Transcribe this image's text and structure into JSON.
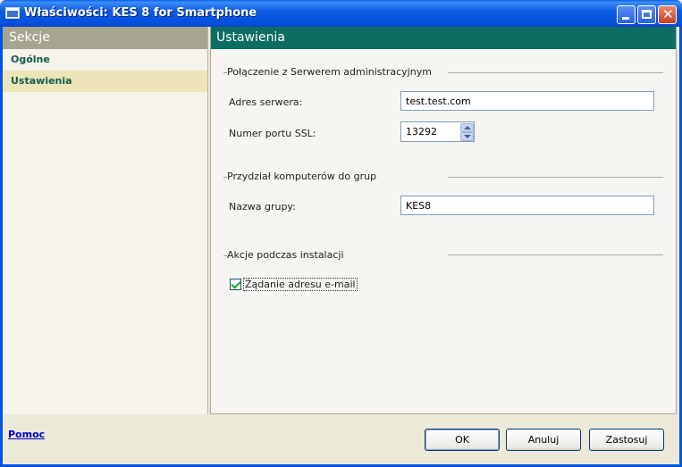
{
  "window": {
    "title": "Właściwości: KES 8 for Smartphone"
  },
  "sections": {
    "header": "Sekcje",
    "items": [
      {
        "label": "Ogólne"
      },
      {
        "label": "Ustawienia"
      }
    ]
  },
  "settings": {
    "header": "Ustawienia",
    "groups": [
      {
        "title": "Połączenie z Serwerem administracyjnym",
        "fields": [
          {
            "label": "Adres serwera:",
            "value": "test.test.com"
          },
          {
            "label": "Numer portu SSL:",
            "value": "13292"
          }
        ]
      },
      {
        "title": "Przydział komputerów do grup",
        "fields": [
          {
            "label": "Nazwa grupy:",
            "value": "KES8"
          }
        ]
      },
      {
        "title": "Akcje podczas instalacji",
        "checkbox": {
          "label": "Żądanie adresu e-mail",
          "checked": true
        }
      }
    ]
  },
  "footer": {
    "help": "Pomoc",
    "ok": "OK",
    "cancel": "Anuluj",
    "apply": "Zastosuj"
  },
  "colors": {
    "titlebar": "#0054e3",
    "settings_header": "#0d6d62",
    "sections_header": "#a6a591",
    "active_section": "#ede4b9"
  }
}
